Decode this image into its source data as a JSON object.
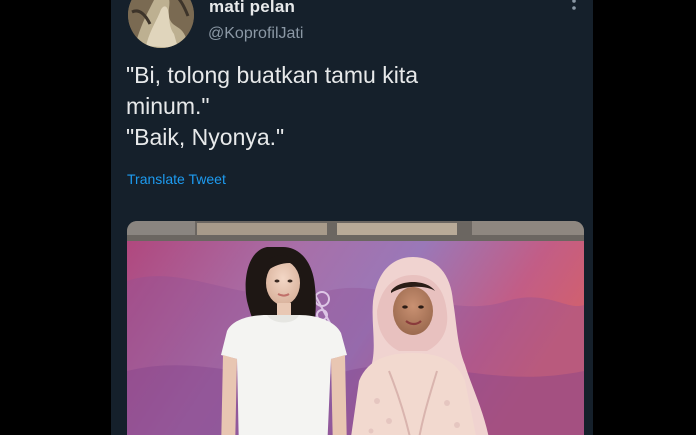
{
  "tweet": {
    "display_name": "mati pelan",
    "handle": "@KoprofilJati",
    "lines": [
      "\"Bi, tolong buatkan tamu kita",
      "minum.\"",
      "\"Baik, Nyonya.\""
    ],
    "translate_label": "Translate Tweet",
    "avatar_icon": "avatar-photo",
    "more_icon": "more-vertical-icon"
  },
  "media": {
    "description_icon": "photo-two-women"
  },
  "colors": {
    "background": "#15202b",
    "text": "#e7e9ea",
    "secondary": "#8b98a5",
    "link": "#1d9bf0"
  }
}
